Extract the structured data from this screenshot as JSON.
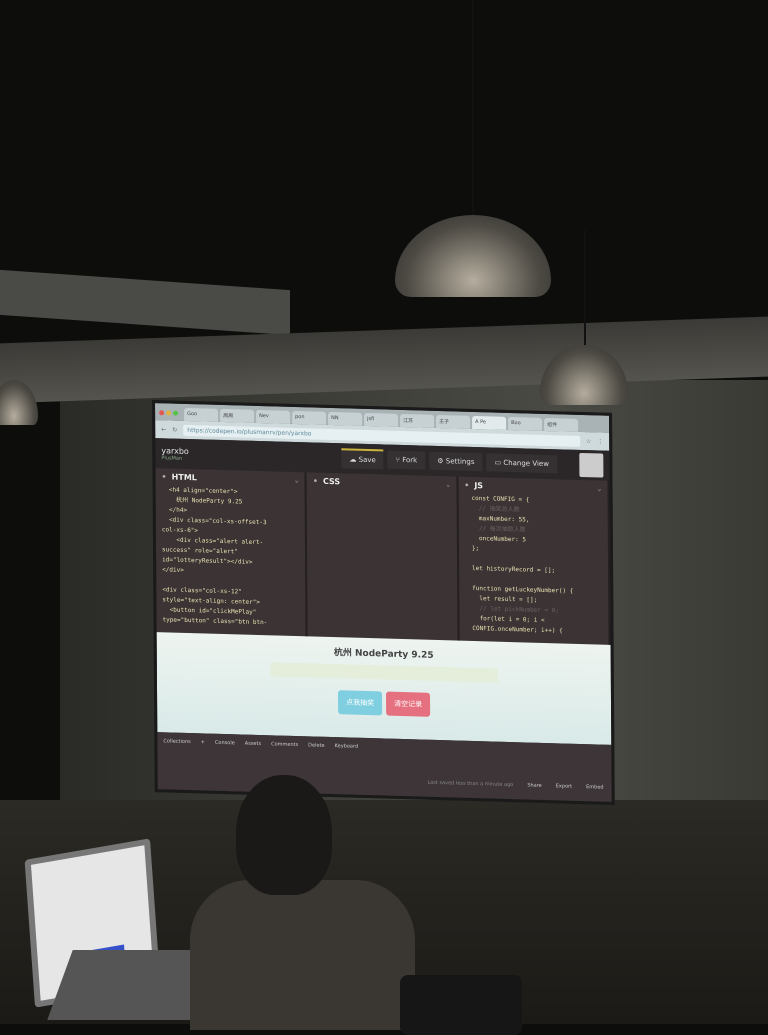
{
  "browser": {
    "tabs": [
      "Goo",
      "周周",
      "Nev",
      "pon",
      "NN",
      "jsfi",
      "江苏",
      "王子",
      "A Pe",
      "Boo",
      "组件"
    ],
    "url": "https://codepen.io/plusmanrv/pen/yarxbo",
    "traffic_lights": [
      "#e0584f",
      "#e2b33e",
      "#59c24a"
    ]
  },
  "codepen": {
    "pen_title": "yarxbo",
    "author": "PlusMan",
    "header_buttons": {
      "save": "Save",
      "fork": "Fork",
      "settings": "Settings",
      "change_view": "Change View"
    },
    "panes": {
      "html": {
        "title": "HTML",
        "lines": [
          "  <h4 align=\"center\">",
          "    杭州 NodeParty 9.25",
          "  </h4>",
          "  <div class=\"col-xs-offset-3",
          "col-xs-6\">",
          "    <div class=\"alert alert-",
          "success\" role=\"alert\"",
          "id=\"lotteryResult\"></div>",
          "</div>",
          "",
          "<div class=\"col-xs-12\"",
          "style=\"text-align: center\">",
          "  <button id=\"clickMePlay\"",
          "type=\"button\" class=\"btn btn-"
        ]
      },
      "css": {
        "title": "CSS",
        "lines": []
      },
      "js": {
        "title": "JS",
        "lines": [
          "  const CONFIG = {",
          "    // 抽奖总人数",
          "    maxNumber: 55,",
          "    // 每次抽取人数",
          "    onceNumber: 5",
          "  };",
          "",
          "  let historyRecord = [];",
          "",
          "  function getLuckeyNumber() {",
          "    let result = [];",
          "    // let pickNumber = 0;",
          "    for(let i = 0; i <",
          "  CONFIG.onceNumber; i++) {"
        ]
      }
    },
    "preview": {
      "heading": "杭州 NodeParty 9.25",
      "draw_button": "点我抽奖",
      "clear_button": "清空记录",
      "draw_color": "#7fcfe0",
      "clear_color": "#e5707f"
    },
    "footer": {
      "left": [
        "Collections",
        "+",
        "Console",
        "Assets",
        "Comments",
        "Delete",
        "Keyboard"
      ],
      "saved": "Last saved less than a minute ago",
      "right": [
        "Share",
        "Export",
        "Embed"
      ]
    }
  }
}
